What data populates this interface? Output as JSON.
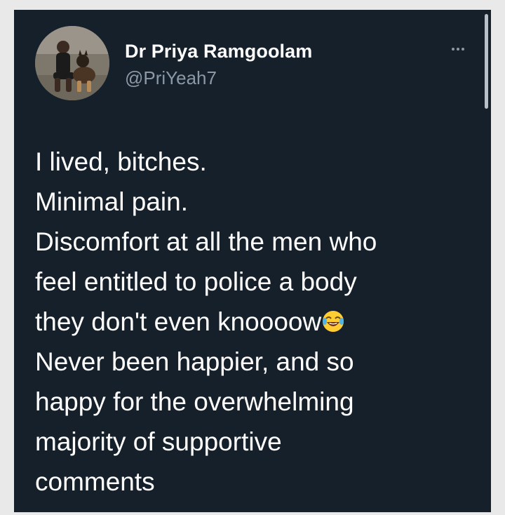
{
  "tweet": {
    "author": {
      "display_name": "Dr Priya Ramgoolam",
      "handle": "@PriYeah7"
    },
    "more_icon": "more-horizontal-icon",
    "lines": [
      "I lived, bitches.",
      "Minimal pain.",
      "Discomfort at all the men who",
      "feel entitled to police a body",
      "they don't even knoooow",
      "Never been happier, and so",
      "happy for the overwhelming",
      "majority of supportive",
      "comments"
    ],
    "emoji": "face-with-tears-of-joy"
  },
  "colors": {
    "card_background": "#15202b",
    "text_primary": "#ffffff",
    "text_secondary": "#8b98a5",
    "page_background": "#e9e9e9"
  }
}
